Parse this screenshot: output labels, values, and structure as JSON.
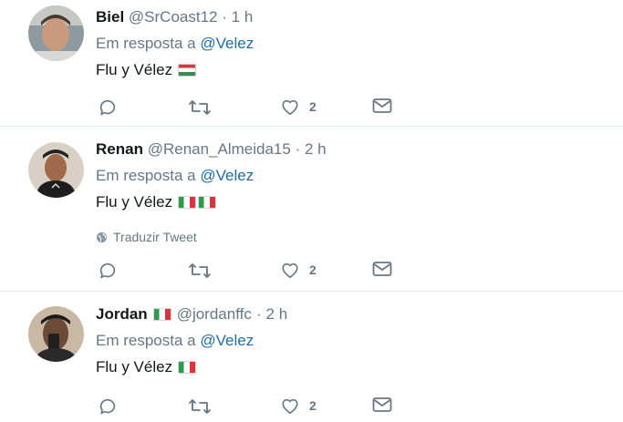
{
  "tweets": [
    {
      "name": "Biel",
      "name_flags": [],
      "handle": "@SrCoast12",
      "separator": "·",
      "time": "1 h",
      "reply_prefix": "Em resposta a",
      "reply_mention": "@Velez",
      "text": "Flu y Vélez",
      "text_flags": [
        "hu"
      ],
      "translate_label": "",
      "likes": "2"
    },
    {
      "name": "Renan",
      "name_flags": [],
      "handle": "@Renan_Almeida15",
      "separator": "·",
      "time": "2 h",
      "reply_prefix": "Em resposta a",
      "reply_mention": "@Velez",
      "text": "Flu y Vélez",
      "text_flags": [
        "it",
        "it"
      ],
      "translate_label": "Traduzir Tweet",
      "likes": "2"
    },
    {
      "name": "Jordan",
      "name_flags": [
        "it"
      ],
      "handle": "@jordanffc",
      "separator": "·",
      "time": "2 h",
      "reply_prefix": "Em resposta a",
      "reply_mention": "@Velez",
      "text": "Flu y Vélez",
      "text_flags": [
        "it"
      ],
      "translate_label": "",
      "likes": "2"
    }
  ],
  "colors": {
    "name": "#14171a",
    "muted": "#657786",
    "mention": "#1b6fa8",
    "divider": "#e6ecf0"
  }
}
